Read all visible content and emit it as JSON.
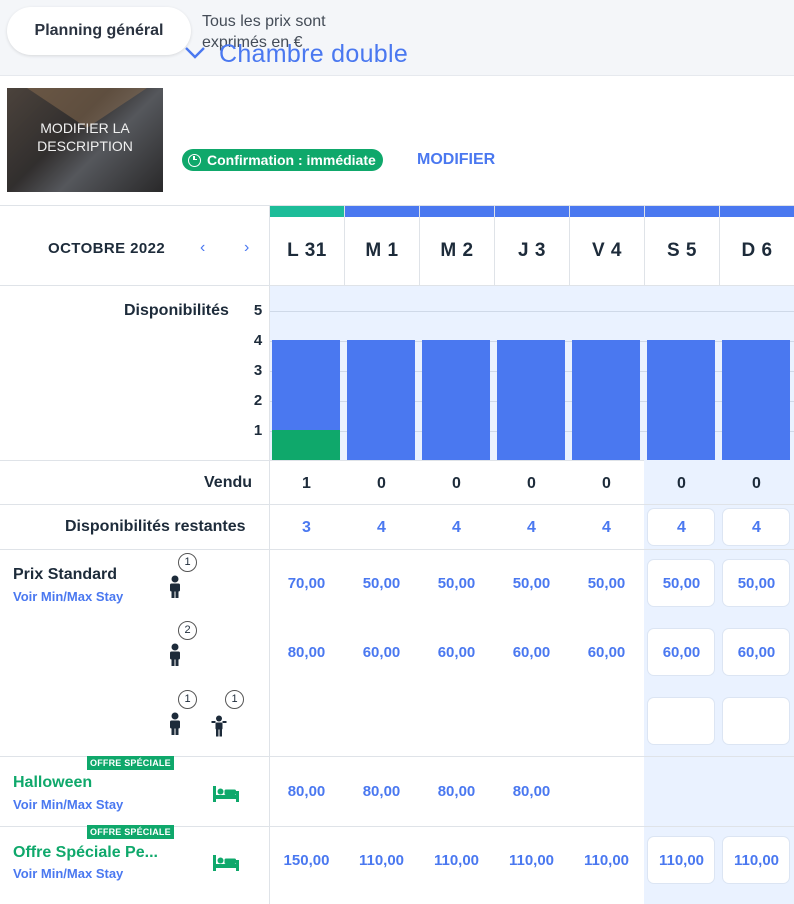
{
  "topbar": {
    "planning_label": "Planning général",
    "price_note": "Tous les prix sont exprimés en €"
  },
  "room": {
    "thumbnail_text": "MODIFIER LA DESCRIPTION",
    "title": "Chambre double",
    "confirmation": "Confirmation : immédiate",
    "modify": "MODIFIER"
  },
  "calendar": {
    "month": "OCTOBRE 2022",
    "prev": "‹",
    "next": "›",
    "days": [
      "L 31",
      "M 1",
      "M 2",
      "J 3",
      "V 4",
      "S 5",
      "D 6"
    ]
  },
  "availability": {
    "label": "Disponibilités",
    "axis_ticks": [
      "5",
      "4",
      "3",
      "2",
      "1"
    ],
    "total": [
      4,
      4,
      4,
      4,
      4,
      4,
      4
    ],
    "sold_levels": [
      1,
      0,
      0,
      0,
      0,
      0,
      0
    ]
  },
  "sold": {
    "label": "Vendu",
    "values": [
      "1",
      "0",
      "0",
      "0",
      "0",
      "0",
      "0"
    ]
  },
  "remaining": {
    "label": "Disponibilités restantes",
    "values": [
      "3",
      "4",
      "4",
      "4",
      "4",
      "4",
      "4"
    ]
  },
  "rates": {
    "standard": {
      "name": "Prix Standard",
      "stay_link": "Voir Min/Max Stay",
      "occupancy": [
        {
          "adults": "1",
          "children": "",
          "prices": [
            "70,00",
            "50,00",
            "50,00",
            "50,00",
            "50,00",
            "50,00",
            "50,00"
          ]
        },
        {
          "adults": "2",
          "children": "",
          "prices": [
            "80,00",
            "60,00",
            "60,00",
            "60,00",
            "60,00",
            "60,00",
            "60,00"
          ]
        },
        {
          "adults": "1",
          "children": "1",
          "prices": [
            "",
            "",
            "",
            "",
            "",
            "",
            ""
          ]
        }
      ]
    },
    "halloween": {
      "badge": "OFFRE SPÉCIALE",
      "name": "Halloween",
      "stay_link": "Voir Min/Max Stay",
      "prices": [
        "80,00",
        "80,00",
        "80,00",
        "80,00",
        "",
        "",
        ""
      ]
    },
    "special": {
      "badge": "OFFRE SPÉCIALE",
      "name": "Offre Spéciale Pe...",
      "stay_link": "Voir Min/Max Stay",
      "prices": [
        "150,00",
        "110,00",
        "110,00",
        "110,00",
        "110,00",
        "110,00",
        "110,00"
      ]
    }
  },
  "colors": {
    "accent_blue": "#4a78f0",
    "green": "#0fa86b",
    "today_strip": "#1dbd99",
    "weekend_bg": "#eaf2ff"
  }
}
